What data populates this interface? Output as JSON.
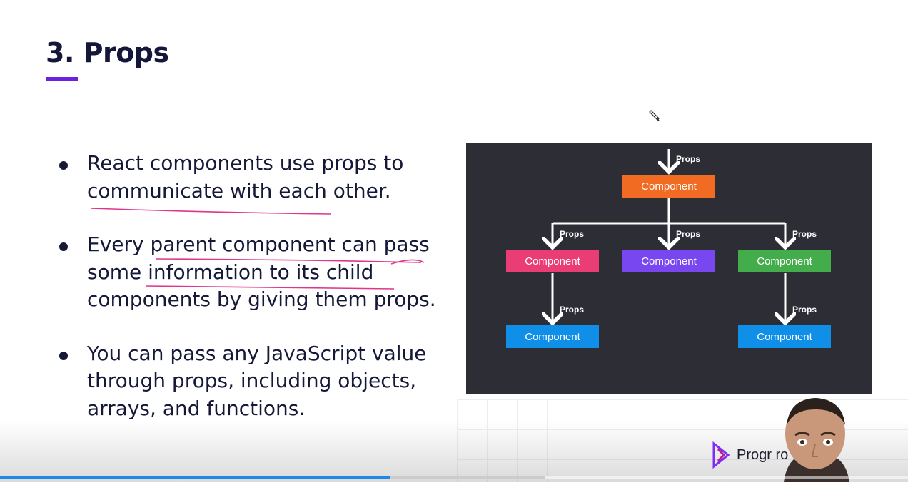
{
  "slide": {
    "title": "3. Props",
    "bullets": [
      {
        "lines": [
          "React components use props to",
          "communicate with each other."
        ]
      },
      {
        "lines": [
          "Every parent component can pass",
          "some information to its child",
          "components by giving them props."
        ]
      },
      {
        "lines": [
          "You can pass any JavaScript value",
          "through props, including objects,",
          "arrays, and functions."
        ]
      }
    ]
  },
  "diagram": {
    "nodes": [
      {
        "id": "root",
        "label": "Component",
        "color": "#f26b22"
      },
      {
        "id": "child-left",
        "label": "Component",
        "color": "#ea3d75"
      },
      {
        "id": "child-middle",
        "label": "Component",
        "color": "#7847f0"
      },
      {
        "id": "child-right",
        "label": "Component",
        "color": "#43ad4b"
      },
      {
        "id": "grandchild-left",
        "label": "Component",
        "color": "#0f8fe8"
      },
      {
        "id": "grandchild-right",
        "label": "Component",
        "color": "#0f8fe8"
      }
    ],
    "edge_label": "Props",
    "background": "#2c2d35"
  },
  "branding": {
    "logo_text": "Progr          ro"
  },
  "player": {
    "progress_fraction": 0.43,
    "buffered_fraction": 0.6
  }
}
